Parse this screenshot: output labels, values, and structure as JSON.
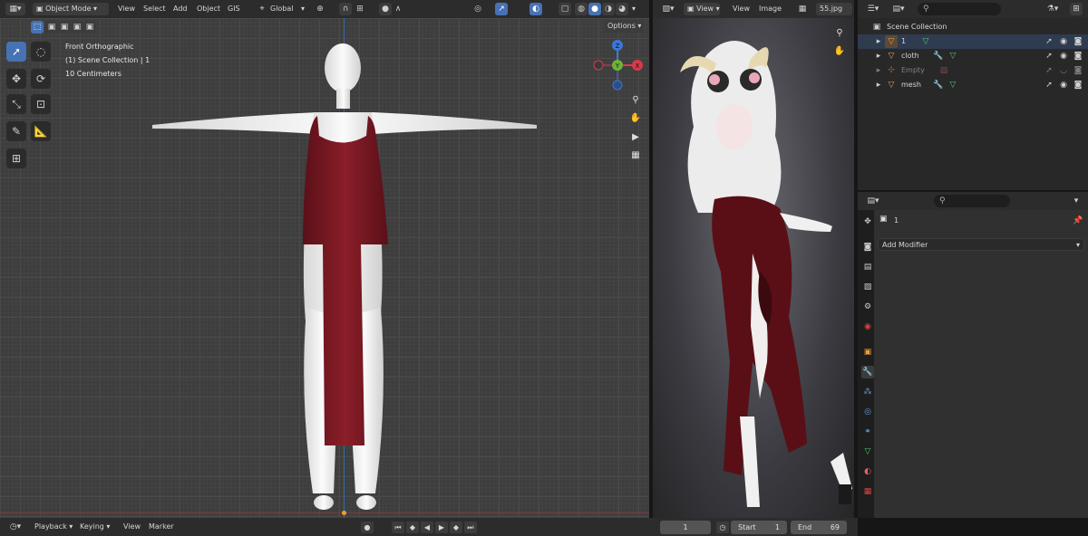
{
  "viewport3d": {
    "mode_label": "Object Mode",
    "menus": [
      "View",
      "Select",
      "Add",
      "Object",
      "GIS"
    ],
    "transform_orientation": "Global",
    "options_label": "Options",
    "overlay": {
      "view_name": "Front Orthographic",
      "collection": "(1) Scene Collection | 1",
      "scale": "10 Centimeters"
    },
    "gizmo": {
      "z": "Z",
      "y": "Y",
      "x": "X"
    }
  },
  "image_editor": {
    "menus": [
      "View",
      "View",
      "Image"
    ],
    "image_name": "55.jpg"
  },
  "outliner": {
    "root_label": "Scene Collection",
    "items": [
      {
        "name": "1",
        "type_icon": "mesh-icon"
      },
      {
        "name": "cloth",
        "type_icon": "mesh-icon"
      },
      {
        "name": "Empty",
        "type_icon": "empty-icon"
      },
      {
        "name": "mesh",
        "type_icon": "mesh-icon"
      }
    ]
  },
  "properties": {
    "object_name": "1",
    "add_modifier_label": "Add Modifier"
  },
  "timeline": {
    "menus": [
      "Playback",
      "Keying",
      "View",
      "Marker"
    ],
    "current_frame": "1",
    "start_label": "Start",
    "start_value": "1",
    "end_label": "End",
    "end_value": "69"
  },
  "colors": {
    "accent": "#4772b3",
    "dress": "#7a1a22",
    "skin": "#f2f2f2",
    "viewport_bg": "#3d3d3d"
  }
}
